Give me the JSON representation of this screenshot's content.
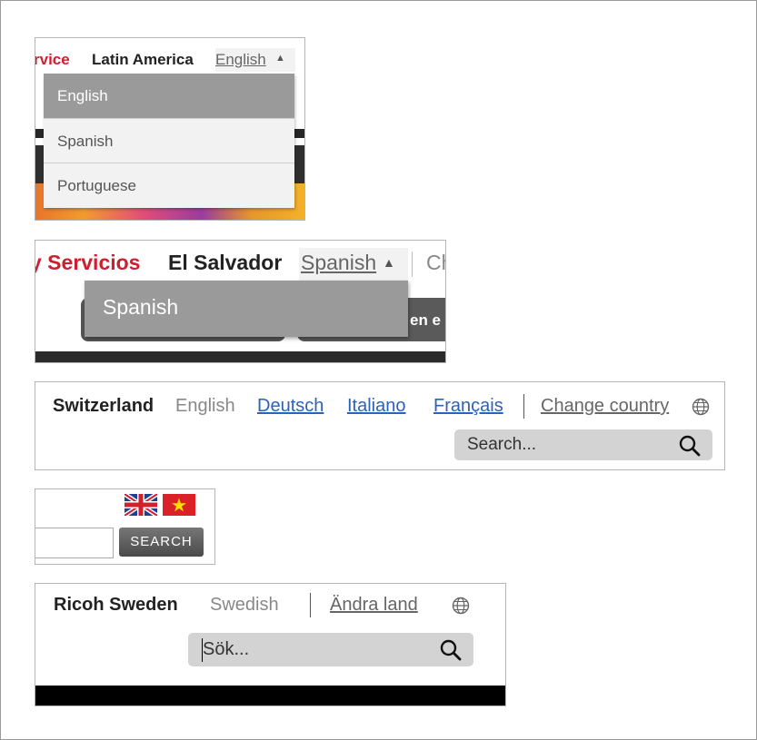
{
  "panel1": {
    "brand": "rvice",
    "region": "Latin America",
    "selected_language": "English",
    "options": [
      "English",
      "Spanish",
      "Portuguese"
    ]
  },
  "panel2": {
    "brand": "y Servicios",
    "region": "El Salvador",
    "selected_language": "Spanish",
    "truncated_link": "Ch",
    "button_text": "en e",
    "options": [
      "Spanish"
    ]
  },
  "panel3": {
    "country": "Switzerland",
    "current_language": "English",
    "languages": [
      "Deutsch",
      "Italiano",
      "Français"
    ],
    "change_country": "Change country",
    "search_placeholder": "Search..."
  },
  "panel4": {
    "flags": [
      "uk-flag",
      "vietnam-flag"
    ],
    "search_button": "SEARCH"
  },
  "panel5": {
    "country": "Ricoh Sweden",
    "current_language": "Swedish",
    "change_country": "Ändra land",
    "search_placeholder": "Sök..."
  },
  "colors": {
    "brand_red": "#cf1f2f",
    "link_blue": "#2b63b8",
    "menu_selected": "#9a9a9a"
  }
}
